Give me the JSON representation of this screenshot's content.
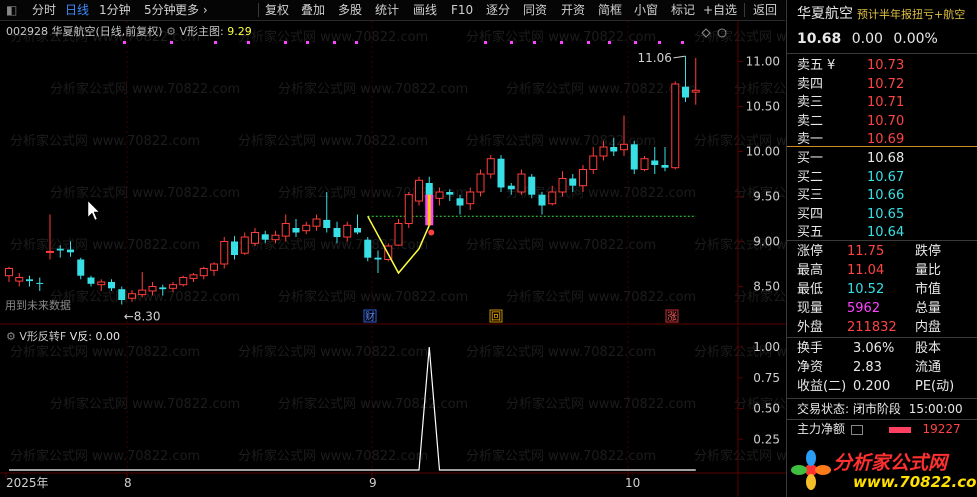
{
  "toolbar": {
    "items": [
      "分时",
      "日线",
      "1分钟",
      "5分钟",
      "更多 ›",
      "复权",
      "叠加",
      "多股",
      "统计",
      "画线",
      "F10",
      "逐分",
      "同资",
      "开资",
      "简框",
      "小窗",
      "标记",
      "+自选",
      "返回"
    ],
    "selected_index": 1
  },
  "chart": {
    "code": "002928",
    "name": "华夏航空",
    "mode": "(日线,前复权)",
    "indicator_name": "V形主图",
    "indicator_value": "9.29",
    "max_label": "11.06",
    "min_label": "8.30",
    "left_note": "用到未来数据",
    "markers": [
      "财",
      "回",
      "涨"
    ],
    "price_ticks": [
      "11.00",
      "10.50",
      "10.00",
      "9.50",
      "9.00",
      "8.50"
    ],
    "date_labels": [
      "2025年",
      "8",
      "9",
      "10"
    ],
    "candles": [
      [
        8.62,
        8.7,
        8.55,
        8.72
      ],
      [
        8.56,
        8.6,
        8.5,
        8.65
      ],
      [
        8.58,
        8.56,
        8.5,
        8.62
      ],
      [
        8.54,
        8.53,
        8.45,
        8.6
      ],
      [
        8.88,
        8.89,
        8.8,
        9.3
      ],
      [
        8.92,
        8.9,
        8.82,
        8.96
      ],
      [
        8.91,
        8.88,
        8.83,
        9.0
      ],
      [
        8.8,
        8.62,
        8.58,
        8.82
      ],
      [
        8.6,
        8.53,
        8.5,
        8.62
      ],
      [
        8.52,
        8.55,
        8.45,
        8.58
      ],
      [
        8.55,
        8.48,
        8.45,
        8.58
      ],
      [
        8.47,
        8.35,
        8.3,
        8.5
      ],
      [
        8.37,
        8.42,
        8.33,
        8.46
      ],
      [
        8.41,
        8.46,
        8.38,
        8.66
      ],
      [
        8.45,
        8.5,
        8.4,
        8.55
      ],
      [
        8.49,
        8.47,
        8.4,
        8.52
      ],
      [
        8.48,
        8.52,
        8.44,
        8.55
      ],
      [
        8.52,
        8.6,
        8.5,
        8.62
      ],
      [
        8.59,
        8.63,
        8.55,
        8.65
      ],
      [
        8.62,
        8.7,
        8.58,
        8.72
      ],
      [
        8.68,
        8.75,
        8.62,
        8.77
      ],
      [
        8.75,
        9.0,
        8.7,
        9.05
      ],
      [
        9.0,
        8.85,
        8.8,
        9.06
      ],
      [
        8.87,
        9.05,
        8.85,
        9.1
      ],
      [
        8.98,
        9.1,
        8.95,
        9.15
      ],
      [
        9.08,
        9.02,
        8.98,
        9.12
      ],
      [
        9.02,
        9.07,
        8.98,
        9.12
      ],
      [
        9.06,
        9.2,
        9.0,
        9.3
      ],
      [
        9.15,
        9.1,
        9.05,
        9.25
      ],
      [
        9.12,
        9.18,
        9.08,
        9.22
      ],
      [
        9.17,
        9.25,
        9.12,
        9.3
      ],
      [
        9.24,
        9.15,
        9.1,
        9.55
      ],
      [
        9.15,
        9.05,
        8.98,
        9.22
      ],
      [
        9.05,
        9.18,
        9.0,
        9.22
      ],
      [
        9.15,
        9.1,
        9.08,
        9.3
      ],
      [
        9.02,
        8.82,
        8.78,
        9.05
      ],
      [
        8.82,
        8.8,
        8.65,
        8.9
      ],
      [
        8.8,
        8.95,
        8.78,
        8.98
      ],
      [
        8.96,
        9.2,
        8.95,
        9.25
      ],
      [
        9.2,
        9.52,
        9.15,
        9.55
      ],
      [
        9.45,
        9.68,
        9.4,
        9.72
      ],
      [
        9.65,
        9.48,
        9.42,
        9.72
      ],
      [
        9.48,
        9.55,
        9.4,
        9.6
      ],
      [
        9.55,
        9.52,
        9.45,
        9.58
      ],
      [
        9.48,
        9.4,
        9.3,
        9.52
      ],
      [
        9.42,
        9.55,
        9.35,
        9.6
      ],
      [
        9.55,
        9.75,
        9.5,
        9.8
      ],
      [
        9.75,
        9.92,
        9.7,
        9.96
      ],
      [
        9.92,
        9.6,
        9.55,
        9.96
      ],
      [
        9.62,
        9.58,
        9.52,
        9.65
      ],
      [
        9.55,
        9.75,
        9.52,
        9.8
      ],
      [
        9.72,
        9.52,
        9.48,
        9.75
      ],
      [
        9.52,
        9.4,
        9.3,
        9.55
      ],
      [
        9.42,
        9.55,
        9.4,
        9.62
      ],
      [
        9.55,
        9.7,
        9.5,
        9.78
      ],
      [
        9.7,
        9.62,
        9.55,
        9.75
      ],
      [
        9.62,
        9.8,
        9.55,
        9.85
      ],
      [
        9.8,
        9.95,
        9.75,
        10.05
      ],
      [
        9.95,
        10.05,
        9.9,
        10.12
      ],
      [
        10.05,
        10.0,
        9.95,
        10.15
      ],
      [
        10.02,
        10.08,
        9.95,
        10.4
      ],
      [
        10.08,
        9.8,
        9.75,
        10.12
      ],
      [
        9.8,
        9.92,
        9.78,
        9.95
      ],
      [
        9.9,
        9.85,
        9.75,
        10.05
      ],
      [
        9.85,
        9.82,
        9.78,
        10.05
      ],
      [
        9.82,
        10.75,
        9.8,
        10.78
      ],
      [
        10.72,
        10.6,
        10.55,
        11.06
      ],
      [
        10.66,
        10.68,
        10.52,
        11.04
      ]
    ],
    "v_pattern": [
      [
        35,
        9.28
      ],
      [
        38,
        8.65
      ],
      [
        40,
        8.92
      ],
      [
        41,
        9.18
      ]
    ],
    "green_level": 9.28
  },
  "sub_chart": {
    "title": "V形反转F",
    "value_label": "V反: 0.00",
    "ticks": [
      "1.00",
      "0.75",
      "0.50",
      "0.25"
    ],
    "spike_index": 41,
    "spike_value": 1.0
  },
  "quote": {
    "name": "华夏航空",
    "ticker_text": "预计半年报扭亏+航空",
    "price": "10.68",
    "change": "0.00",
    "change_pct": "0.00%",
    "asks": [
      [
        "卖五",
        "¥",
        "10.73"
      ],
      [
        "卖四",
        "",
        "10.72"
      ],
      [
        "卖三",
        "",
        "10.71"
      ],
      [
        "卖二",
        "",
        "10.70"
      ],
      [
        "卖一",
        "",
        "10.69"
      ]
    ],
    "bids": [
      [
        "买一",
        "10.68"
      ],
      [
        "买二",
        "10.67"
      ],
      [
        "买三",
        "10.66"
      ],
      [
        "买四",
        "10.65"
      ],
      [
        "买五",
        "10.64"
      ]
    ],
    "stats": [
      [
        "涨停",
        "11.75",
        "跌停"
      ],
      [
        "最高",
        "11.04",
        "量比"
      ],
      [
        "最低",
        "10.52",
        "市值"
      ],
      [
        "现量",
        "5962",
        "总量"
      ],
      [
        "外盘",
        "211832",
        "内盘"
      ]
    ],
    "stats2": [
      [
        "换手",
        "3.06%",
        "股本"
      ],
      [
        "净资",
        "2.83",
        "流通"
      ],
      [
        "收益(二)",
        "0.200",
        "PE(动)"
      ]
    ],
    "trade_status_label": "交易状态:",
    "trade_status_value": "闭市阶段",
    "trade_time": "15:00:00",
    "main_flow_label": "主力净额",
    "main_flow_value": "19227"
  },
  "watermark": "分析家公式网 www.70822.com",
  "logo": {
    "text": "分析家公式网",
    "url": "www.70822.com"
  },
  "colors": {
    "up": "#ff3c3c",
    "down": "#38e0e6",
    "v_line": "#ffff40",
    "level_line": "#3cdc3c",
    "magenta": "#ff44ff",
    "grid": "#3a0000"
  }
}
